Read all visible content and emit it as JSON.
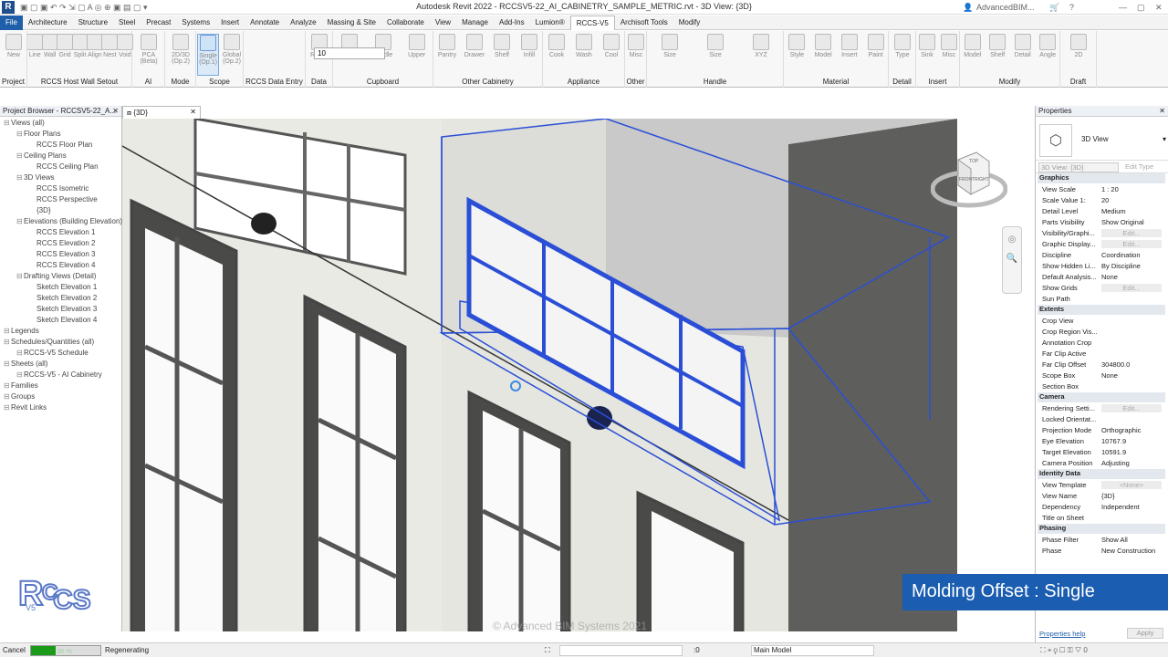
{
  "window": {
    "title": "Autodesk Revit 2022 - RCCSV5-22_AI_CABINETRY_SAMPLE_METRIC.rvt - 3D View: {3D}",
    "user": "AdvancedBIM..."
  },
  "tabs": [
    "File",
    "Architecture",
    "Structure",
    "Steel",
    "Precast",
    "Systems",
    "Insert",
    "Annotate",
    "Analyze",
    "Massing & Site",
    "Collaborate",
    "View",
    "Manage",
    "Add-Ins",
    "Lumion®",
    "RCCS-V5",
    "Archisoft Tools",
    "Modify"
  ],
  "active_tab": "RCCS-V5",
  "ribbon": {
    "groups": [
      {
        "label": "Project",
        "buttons": [
          "New"
        ]
      },
      {
        "label": "RCCS Host Wall Setout",
        "buttons": [
          "Line",
          "Wall",
          "Grid",
          "Split",
          "Align",
          "Nest",
          "Void"
        ]
      },
      {
        "label": "AI",
        "buttons": [
          "PCA (Beta)"
        ]
      },
      {
        "label": "Mode",
        "buttons": [
          "2D/3D (Op.2)"
        ]
      },
      {
        "label": "Scope",
        "buttons": [
          "Single (Op.1)",
          "Global (Op.2)"
        ]
      },
      {
        "label": "RCCS Data Entry",
        "buttons": []
      },
      {
        "label": "Data",
        "buttons": [
          "RCCS"
        ]
      },
      {
        "label": "Cupboard",
        "buttons": [
          "Lower",
          "Middle",
          "Upper"
        ]
      },
      {
        "label": "Other Cabinetry",
        "buttons": [
          "Pantry",
          "Drawer",
          "Shelf",
          "Infill"
        ]
      },
      {
        "label": "Appliance",
        "buttons": [
          "Cook",
          "Wash",
          "Cool"
        ]
      },
      {
        "label": "Other",
        "buttons": [
          "Misc"
        ]
      },
      {
        "label": "Handle",
        "buttons": [
          "Size",
          "Size",
          "XYZ"
        ]
      },
      {
        "label": "Material",
        "buttons": [
          "Style",
          "Model",
          "Insert",
          "Paint"
        ]
      },
      {
        "label": "Detail",
        "buttons": [
          "Type"
        ]
      },
      {
        "label": "Insert",
        "buttons": [
          "Sink",
          "Misc"
        ]
      },
      {
        "label": "Modify",
        "buttons": [
          "Model",
          "Shelf",
          "Detail",
          "Angle"
        ]
      },
      {
        "label": "Draft",
        "buttons": [
          "2D"
        ]
      }
    ],
    "data_entry_value": "10"
  },
  "project_browser": {
    "title": "Project Browser - RCCSV5-22_A...",
    "items": [
      {
        "label": "Views (all)",
        "level": 0
      },
      {
        "label": "Floor Plans",
        "level": 1
      },
      {
        "label": "RCCS Floor Plan",
        "level": 2
      },
      {
        "label": "Ceiling Plans",
        "level": 1
      },
      {
        "label": "RCCS Ceiling Plan",
        "level": 2
      },
      {
        "label": "3D Views",
        "level": 1
      },
      {
        "label": "RCCS Isometric",
        "level": 2
      },
      {
        "label": "RCCS Perspective",
        "level": 2
      },
      {
        "label": "{3D}",
        "level": 2
      },
      {
        "label": "Elevations (Building Elevation)",
        "level": 1
      },
      {
        "label": "RCCS Elevation 1",
        "level": 2
      },
      {
        "label": "RCCS Elevation 2",
        "level": 2
      },
      {
        "label": "RCCS Elevation 3",
        "level": 2
      },
      {
        "label": "RCCS Elevation 4",
        "level": 2
      },
      {
        "label": "Drafting Views (Detail)",
        "level": 1
      },
      {
        "label": "Sketch Elevation 1",
        "level": 2
      },
      {
        "label": "Sketch Elevation 2",
        "level": 2
      },
      {
        "label": "Sketch Elevation 3",
        "level": 2
      },
      {
        "label": "Sketch Elevation 4",
        "level": 2
      },
      {
        "label": "Legends",
        "level": 0
      },
      {
        "label": "Schedules/Quantities (all)",
        "level": 0
      },
      {
        "label": "RCCS-V5 Schedule",
        "level": 1
      },
      {
        "label": "Sheets (all)",
        "level": 0
      },
      {
        "label": "RCCS-V5 - AI Cabinetry",
        "level": 1
      },
      {
        "label": "Families",
        "level": 0
      },
      {
        "label": "Groups",
        "level": 0
      },
      {
        "label": "Revit Links",
        "level": 0
      }
    ]
  },
  "view_tab": "{3D}",
  "properties": {
    "title": "Properties",
    "type_name": "3D View",
    "selector": "3D View: {3D}",
    "edit_type": "Edit Type",
    "sections": [
      {
        "name": "Graphics",
        "rows": [
          [
            "View Scale",
            "1 : 20"
          ],
          [
            "Scale Value 1:",
            "20"
          ],
          [
            "Detail Level",
            "Medium"
          ],
          [
            "Parts Visibility",
            "Show Original"
          ],
          [
            "Visibility/Graphi...",
            "Edit..."
          ],
          [
            "Graphic Display...",
            "Edit..."
          ],
          [
            "Discipline",
            "Coordination"
          ],
          [
            "Show Hidden Li...",
            "By Discipline"
          ],
          [
            "Default Analysis...",
            "None"
          ],
          [
            "Show Grids",
            "Edit..."
          ],
          [
            "Sun Path",
            ""
          ]
        ]
      },
      {
        "name": "Extents",
        "rows": [
          [
            "Crop View",
            ""
          ],
          [
            "Crop Region Vis...",
            ""
          ],
          [
            "Annotation Crop",
            ""
          ],
          [
            "Far Clip Active",
            ""
          ],
          [
            "Far Clip Offset",
            "304800.0"
          ],
          [
            "Scope Box",
            "None"
          ],
          [
            "Section Box",
            ""
          ]
        ]
      },
      {
        "name": "Camera",
        "rows": [
          [
            "Rendering Setti...",
            "Edit..."
          ],
          [
            "Locked Orientat...",
            ""
          ],
          [
            "Projection Mode",
            "Orthographic"
          ],
          [
            "Eye Elevation",
            "10767.9"
          ],
          [
            "Target Elevation",
            "10591.9"
          ],
          [
            "Camera Position",
            "Adjusting"
          ]
        ]
      },
      {
        "name": "Identity Data",
        "rows": [
          [
            "View Template",
            "<None>"
          ],
          [
            "View Name",
            "{3D}"
          ],
          [
            "Dependency",
            "Independent"
          ],
          [
            "Title on Sheet",
            ""
          ]
        ]
      },
      {
        "name": "Phasing",
        "rows": [
          [
            "Phase Filter",
            "Show All"
          ],
          [
            "Phase",
            "New Construction"
          ]
        ]
      }
    ],
    "help": "Properties help",
    "apply": "Apply"
  },
  "status": {
    "cancel": "Cancel",
    "progress": "36 %",
    "progress_fraction": 0.36,
    "message": "Regenerating",
    "coord": ":0",
    "model": "Main Model"
  },
  "overlay": "Molding Offset : Single",
  "watermark": "© Advanced BIM Systems 2021",
  "navcube": {
    "face": "FRONT",
    "side": "RIGHT",
    "top": "TOP"
  },
  "colors": {
    "accent": "#1a5db1",
    "file_tab": "#1f5ea8",
    "selection": "#1f3fd1"
  }
}
